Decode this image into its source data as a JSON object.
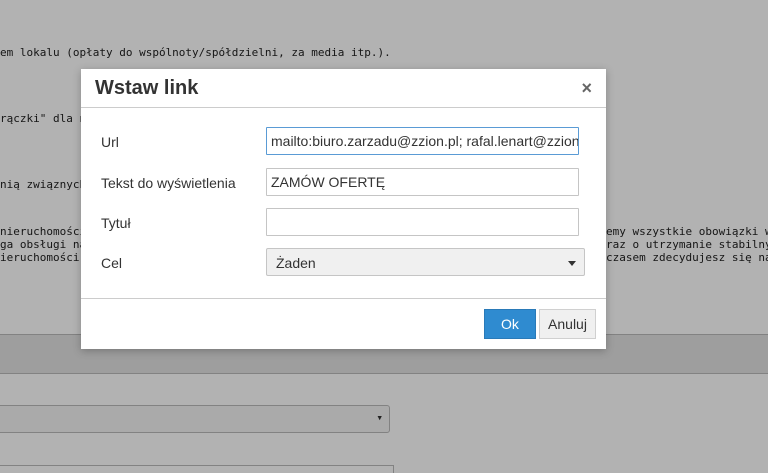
{
  "background": {
    "lines": [
      "em lokalu (opłaty do wspólnoty/spółdzielni, za media itp.).",
      "rączki\" dla nap",
      "nią związnych.",
      "nieruchomości,",
      "ga obsługi naj",
      "ieruchomości. W",
      "emy wszystkie obowiązki wyn",
      "raz o utrzymanie stabilnych",
      "czasem zdecydujesz się na j"
    ],
    "select_caret": "▾"
  },
  "dialog": {
    "title": "Wstaw link",
    "close_symbol": "×",
    "fields": {
      "url": {
        "label": "Url",
        "value": "mailto:biuro.zarzadu@zzion.pl; rafal.lenart@zzion.pl"
      },
      "text": {
        "label": "Tekst do wyświetlenia",
        "value": "ZAMÓW OFERTĘ"
      },
      "title": {
        "label": "Tytuł",
        "value": ""
      },
      "target": {
        "label": "Cel",
        "value": "Żaden"
      }
    },
    "buttons": {
      "ok": "Ok",
      "cancel": "Anuluj"
    },
    "colors": {
      "primary": "#2f8bd0",
      "focus_border": "#5a9bd5"
    }
  }
}
